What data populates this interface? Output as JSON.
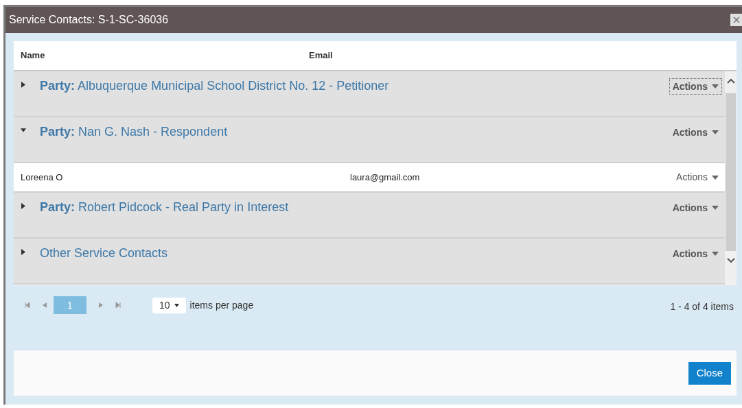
{
  "window": {
    "title": "Service Contacts: S-1-SC-36036"
  },
  "table": {
    "columns": [
      "Name",
      "Email"
    ],
    "groups": [
      {
        "label": "**Party:** Albuquerque Municipal School District No. 12 - Petitioner",
        "expanded": false,
        "focused": true,
        "actions": "Actions"
      },
      {
        "label": "**Party:** Nan G. Nash - Respondent",
        "expanded": true,
        "focused": false,
        "actions": "Actions",
        "contacts": [
          {
            "name": "Loreena O",
            "email": "laura@gmail.com",
            "actions": "Actions"
          }
        ]
      },
      {
        "label": "**Party:** Robert Pidcock - Real Party in Interest",
        "expanded": false,
        "focused": false,
        "actions": "Actions"
      },
      {
        "label": "Other Service Contacts",
        "expanded": false,
        "focused": false,
        "actions": "Actions"
      }
    ]
  },
  "pager": {
    "pages": [
      {
        "label": "1",
        "selected": true
      }
    ],
    "page_size": "10",
    "page_size_label": "items per page",
    "summary": "1 - 4 of 4 items"
  },
  "buttons": [
    "Close"
  ]
}
